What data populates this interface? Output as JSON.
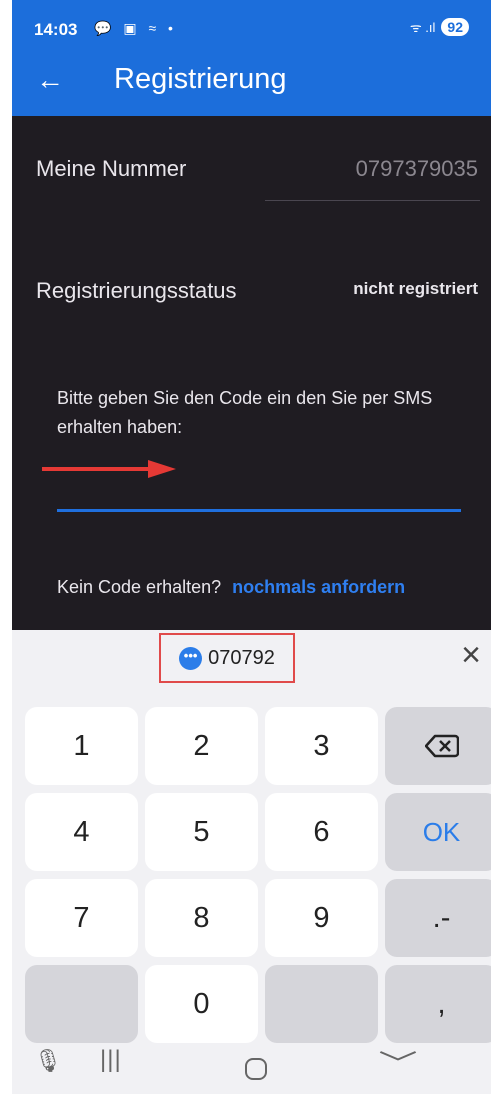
{
  "status_bar": {
    "time": "14:03",
    "notification_icons": "💬 ▣ ≈ •",
    "signal": "ᯤ .ıl",
    "battery": "92"
  },
  "app_bar": {
    "back_icon": "←",
    "title": "Registrierung"
  },
  "form": {
    "number_label": "Meine Nummer",
    "number_value": "0797379035",
    "status_label": "Registrierungsstatus",
    "status_value": "nicht registriert",
    "instructions": "Bitte geben Sie den Code ein den Sie per SMS erhalten haben:",
    "code_value": "",
    "no_code_text": "Kein Code erhalten?",
    "resend_link": "nochmals anfordern"
  },
  "keyboard": {
    "suggestion": "070792",
    "close_icon": "×",
    "keys": {
      "k1": "1",
      "k2": "2",
      "k3": "3",
      "backspace": "⌫",
      "k4": "4",
      "k5": "5",
      "k6": "6",
      "ok": "OK",
      "k7": "7",
      "k8": "8",
      "k9": "9",
      "dot_dash": ".-",
      "k0": "0",
      "comma": ","
    }
  },
  "nav_bar": {
    "mic_icon": "🎙",
    "recents_icon": "|||",
    "back_icon": "﹀"
  },
  "colors": {
    "app_blue": "#1c6edb",
    "background_dark": "#1f1c22",
    "link_blue": "#2f7ff0",
    "highlight_red": "#e04a4a",
    "arrow_red": "#e53935"
  }
}
